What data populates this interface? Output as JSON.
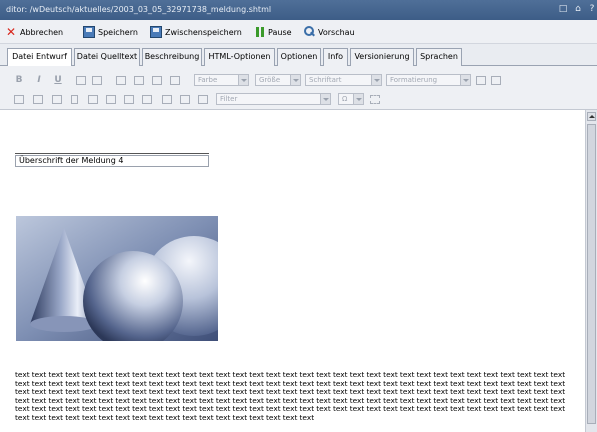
{
  "window": {
    "title": "ditor: /wDeutsch/aktuelles/2003_03_05_32971738_meldung.shtml",
    "controls": [
      "□",
      "⌂",
      "?"
    ]
  },
  "toolbar": {
    "cancel_label": "Abbrechen",
    "save_label": "Speichern",
    "save_temp_label": "Zwischenspeichern",
    "pause_label": "Pause",
    "preview_label": "Vorschau"
  },
  "tabs": [
    {
      "label": "Datei Entwurf",
      "active": true
    },
    {
      "label": "Datei Quelltext",
      "active": false
    },
    {
      "label": "Beschreibung",
      "active": false
    },
    {
      "label": "HTML-Optionen",
      "active": false
    },
    {
      "label": "Optionen",
      "active": false
    },
    {
      "label": "Info",
      "active": false
    },
    {
      "label": "Versionierung",
      "active": false
    },
    {
      "label": "Sprachen",
      "active": false
    }
  ],
  "format": {
    "bold": "B",
    "italic": "I",
    "underline": "U",
    "color_combo": "Farbe",
    "size_combo": "Größe",
    "font_combo": "Schriftart",
    "style_combo": "Formatierung",
    "filter_combo": "Filter",
    "omega_combo": "Ω"
  },
  "editor": {
    "headline": "Überschrift der Meldung 4",
    "body_text": "text text text text text text text text text text text text text text text text text text text text text text text text text text text text text text text text text text text text text text text text text text text text text text text text text text text text text text text text text text text text text text text text text text text text text text text text text text text text text text text text text text text text text text text text text text text text text text text text text text text text text text text text text text text text text text text text text text text text text text text text text text text text text text text text text text text text text text text text text text text text text text text text text text text text text text text text text text text text text text text text text text text text text text text text text text text text text text text text text text text text text text text"
  }
}
